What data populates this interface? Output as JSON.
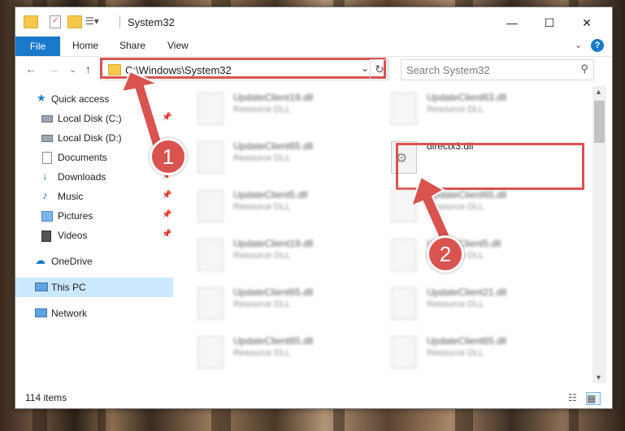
{
  "window": {
    "title": "System32",
    "controls": {
      "minimize": "—",
      "maximize": "☐",
      "close": "✕"
    }
  },
  "ribbon": {
    "tabs": [
      "File",
      "Home",
      "Share",
      "View"
    ],
    "help": "?",
    "collapse": "⌄"
  },
  "address": {
    "path": "C:\\Windows\\System32",
    "dropdown": "⌄",
    "refresh": "↻"
  },
  "search": {
    "placeholder": "Search System32",
    "icon": "⚲"
  },
  "nav_buttons": {
    "back": "←",
    "forward": "→",
    "recent": "⌄",
    "up": "↑"
  },
  "nav_pane": {
    "items": [
      {
        "label": "Quick access",
        "icon": "star-icon",
        "pinned": false
      },
      {
        "label": "Local Disk (C:)",
        "icon": "drive-icon",
        "pinned": true
      },
      {
        "label": "Local Disk (D:)",
        "icon": "drive-icon",
        "pinned": false
      },
      {
        "label": "Documents",
        "icon": "documents-icon",
        "pinned": true
      },
      {
        "label": "Downloads",
        "icon": "download-icon",
        "pinned": true
      },
      {
        "label": "Music",
        "icon": "music-icon",
        "pinned": true
      },
      {
        "label": "Pictures",
        "icon": "pictures-icon",
        "pinned": true
      },
      {
        "label": "Videos",
        "icon": "videos-icon",
        "pinned": true
      },
      {
        "label": "OneDrive",
        "icon": "cloud-icon",
        "pinned": false
      },
      {
        "label": "This PC",
        "icon": "computer-icon",
        "pinned": false,
        "selected": true
      },
      {
        "label": "Network",
        "icon": "network-icon",
        "pinned": false
      }
    ],
    "pin_glyph": "📌"
  },
  "files": [
    {
      "name": "UpdateClient19.dll",
      "type": "Resource DLL",
      "blurred": true
    },
    {
      "name": "UpdateClient63.dll",
      "type": "Resource DLL",
      "blurred": true
    },
    {
      "name": "UpdateClient65.dll",
      "type": "Resource DLL",
      "blurred": true
    },
    {
      "name": "directx3.dll",
      "type": "",
      "blurred": false,
      "highlighted": true
    },
    {
      "name": "UpdateClient5.dll",
      "type": "Resource DLL",
      "blurred": true
    },
    {
      "name": "UpdateClient65.dll",
      "type": "Resource DLL",
      "blurred": true
    },
    {
      "name": "UpdateClient19.dll",
      "type": "Resource DLL",
      "blurred": true
    },
    {
      "name": "UpdateClient5.dll",
      "type": "Resource DLL",
      "blurred": true
    },
    {
      "name": "UpdateClient65.dll",
      "type": "Resource DLL",
      "blurred": true
    },
    {
      "name": "UpdateClient21.dll",
      "type": "Resource DLL",
      "blurred": true
    },
    {
      "name": "UpdateClient65.dll",
      "type": "Resource DLL",
      "blurred": true
    },
    {
      "name": "UpdateClient65.dll",
      "type": "Resource DLL",
      "blurred": true
    }
  ],
  "status": {
    "item_count": "114 items"
  },
  "annotations": {
    "step1": "1",
    "step2": "2",
    "color": "#d9534f"
  }
}
